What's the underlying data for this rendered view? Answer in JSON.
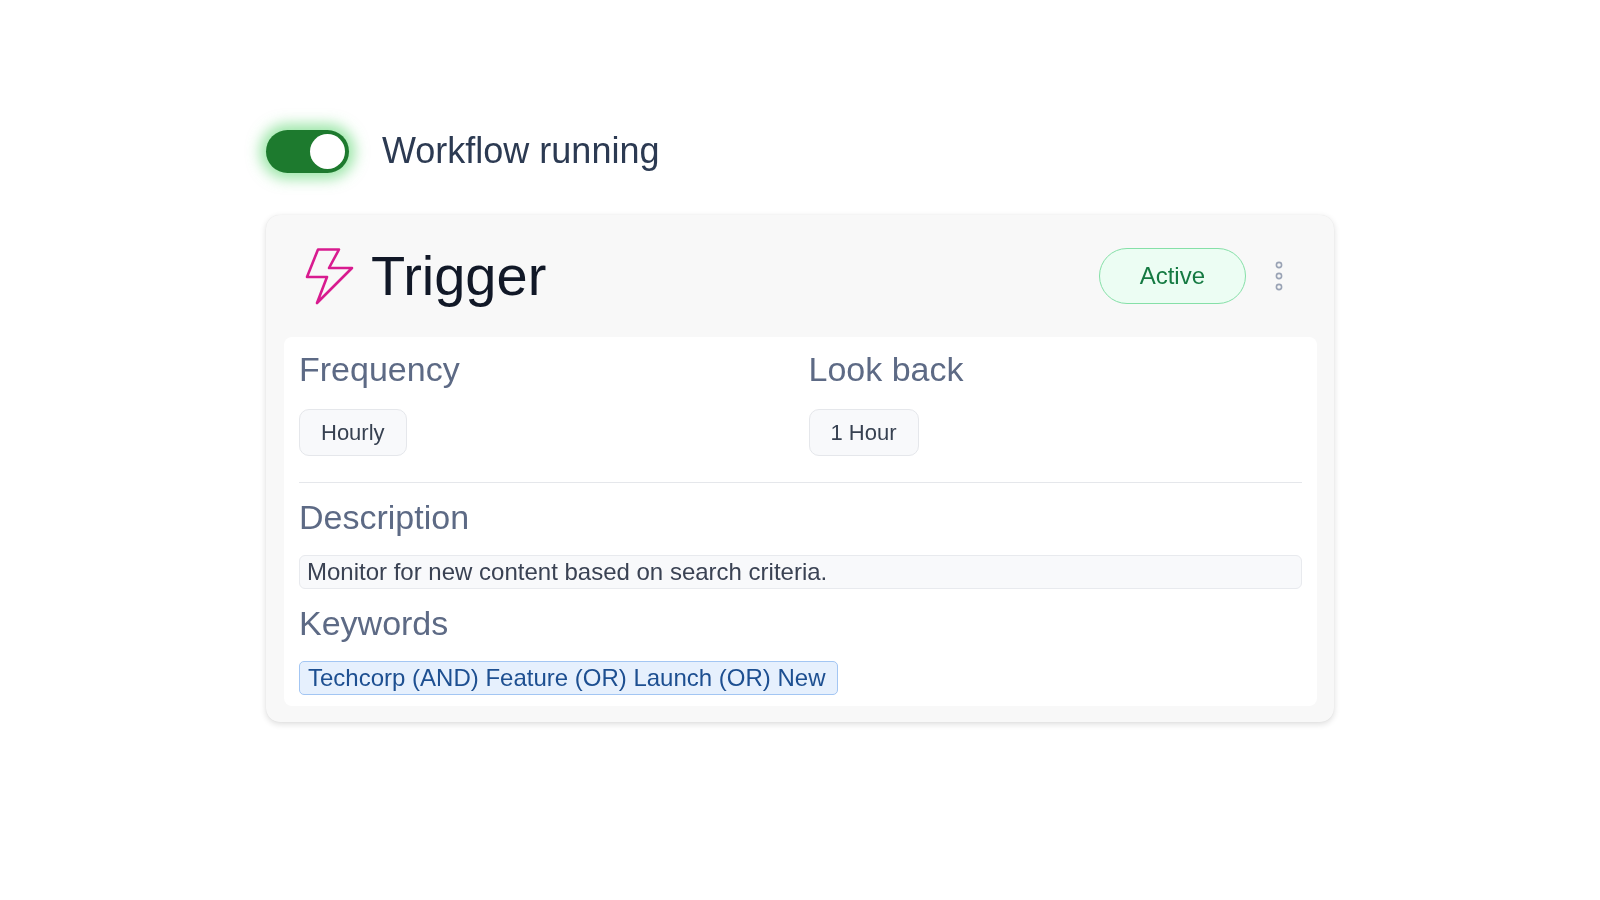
{
  "workflow_toggle": {
    "label": "Workflow running",
    "on": true
  },
  "trigger": {
    "title": "Trigger",
    "status": "Active",
    "settings": [
      {
        "label": "Frequency",
        "value": "Hourly"
      },
      {
        "label": "Look back",
        "value": "1 Hour"
      }
    ],
    "description": {
      "label": "Description",
      "value": "Monitor for new content based on search criteria."
    },
    "keywords": {
      "label": "Keywords",
      "tags": [
        "Techcorp (AND) Feature (OR) Launch (OR) New"
      ]
    }
  }
}
